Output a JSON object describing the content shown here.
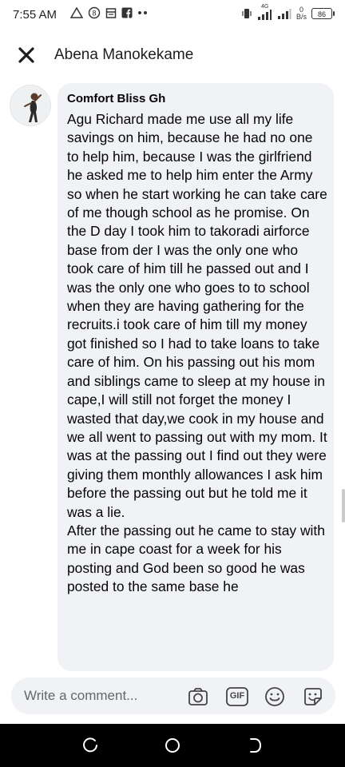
{
  "status_bar": {
    "time": "7:55 AM",
    "left_icons": [
      "warning-icon",
      "notification-8-icon",
      "calendar-icon",
      "facebook-icon",
      "more-dots-icon"
    ],
    "network": "4G",
    "speed_value": "0",
    "speed_unit": "B/s",
    "battery": "86"
  },
  "header": {
    "title": "Abena Manokekame"
  },
  "comment": {
    "author": "Comfort Bliss Gh",
    "text": "Agu Richard made me use all my life savings on him, because he had no one to help him, because I was the girlfriend he asked me to help him enter the Army so when he start working he can take care of me though school as he promise. On the D day I took him to takoradi airforce base from der I was the only one who took care of him till he passed out and I was the only one who goes to to school when they are having gathering for the recruits.i took care of him till my money got finished so I had to take loans to take care of him. On his passing out his mom and siblings came to sleep at my house in cape,I will still not forget the money I wasted that day,we cook in my house and we all went to passing out with my mom. It was at the passing out I find out they were giving them monthly allowances I ask him before the passing out but he told me it was a lie.\nAfter the passing out he came to stay with me in cape coast for a week for his posting and God been so good he was posted to the same base he"
  },
  "composer": {
    "placeholder": "Write a comment...",
    "gif_label": "GIF",
    "icons": [
      "camera-icon",
      "gif-icon",
      "emoji-icon",
      "sticker-icon"
    ]
  },
  "nav_bar": {
    "icons": [
      "recent-apps-icon",
      "home-icon",
      "back-icon"
    ]
  },
  "colors": {
    "bubble": "#f0f2f5",
    "text": "#050505",
    "secondary": "#65676b",
    "nav_bar": "#000000"
  }
}
